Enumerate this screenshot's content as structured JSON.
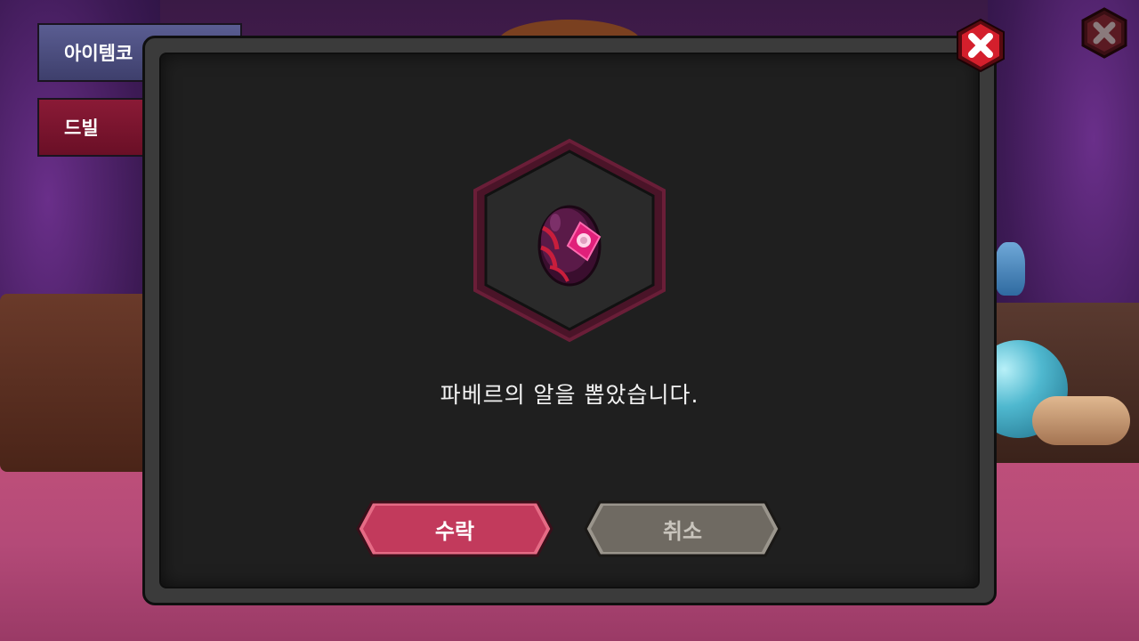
{
  "menu": {
    "item_code_label": "아이템코",
    "drill_label": "드빌"
  },
  "dialog": {
    "message": "파베르의 알을 뽑았습니다.",
    "item": {
      "icon": "dark-magenta-egg-icon"
    },
    "accept_label": "수락",
    "cancel_label": "취소"
  },
  "colors": {
    "accept": "#c23a5c",
    "cancel": "#6f6a62",
    "close": "#d41f2c",
    "hex_border": "#5a1830"
  }
}
